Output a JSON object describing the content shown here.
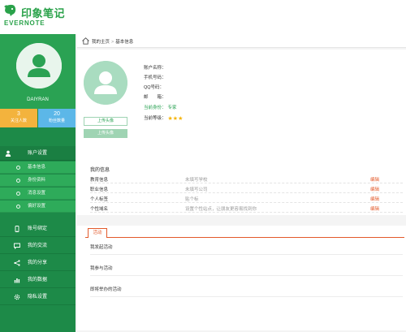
{
  "header": {
    "brand_cn": "印象笔记",
    "brand_en": "EVERNOTE"
  },
  "profile": {
    "username": "DAIYRAN",
    "stats": [
      {
        "value": "3",
        "label": "关注人数"
      },
      {
        "value": "20",
        "label": "粉丝数量"
      }
    ]
  },
  "sidebar": {
    "group": {
      "label": "账户设置",
      "icon": "person-icon"
    },
    "subitems": [
      {
        "label": "基本信息"
      },
      {
        "label": "身份资料"
      },
      {
        "label": "消息设置"
      },
      {
        "label": "偏好设置"
      }
    ],
    "items": [
      {
        "label": "账号绑定",
        "icon": "phone-icon"
      },
      {
        "label": "我的交流",
        "icon": "chat-icon"
      },
      {
        "label": "我的分享",
        "icon": "share-icon"
      },
      {
        "label": "我的数据",
        "icon": "chart-icon"
      },
      {
        "label": "隐私设置",
        "icon": "gear-icon"
      }
    ]
  },
  "breadcrumb": {
    "home": "我的主页",
    "separator": ">",
    "current": "基本信息"
  },
  "account": {
    "upload_label": "上传头像",
    "save_label": "上传头像",
    "fields": [
      {
        "key": "账户名称：",
        "value": ""
      },
      {
        "key": "手机号码：",
        "value": ""
      },
      {
        "key": "QQ号码：",
        "value": ""
      },
      {
        "key": "邮　　箱：",
        "value": ""
      },
      {
        "key": "当前身份：",
        "value": "专家"
      },
      {
        "key": "当前等级：",
        "value": ""
      }
    ],
    "stars": [
      "★",
      "★",
      "★"
    ]
  },
  "my_info": {
    "title": "我的信息",
    "rows": [
      {
        "key": "教育信息",
        "value": "未填写学校",
        "edit": "编辑"
      },
      {
        "key": "职业信息",
        "value": "未填写公司",
        "edit": "编辑"
      },
      {
        "key": "个人标签",
        "value": "贴个标",
        "edit": "编辑"
      },
      {
        "key": "个性域名",
        "value": "设置个性站点，让朋友更容易找到你",
        "edit": "编辑"
      }
    ]
  },
  "activity": {
    "tab": "活动",
    "rows": [
      "我发起活动",
      "我参与活动",
      "即将举办的活动"
    ]
  },
  "colors": {
    "brand_green": "#2aa24a",
    "sidebar_green": "#1d8a48",
    "accent_orange": "#e35a2b",
    "star_yellow": "#f5b301"
  }
}
